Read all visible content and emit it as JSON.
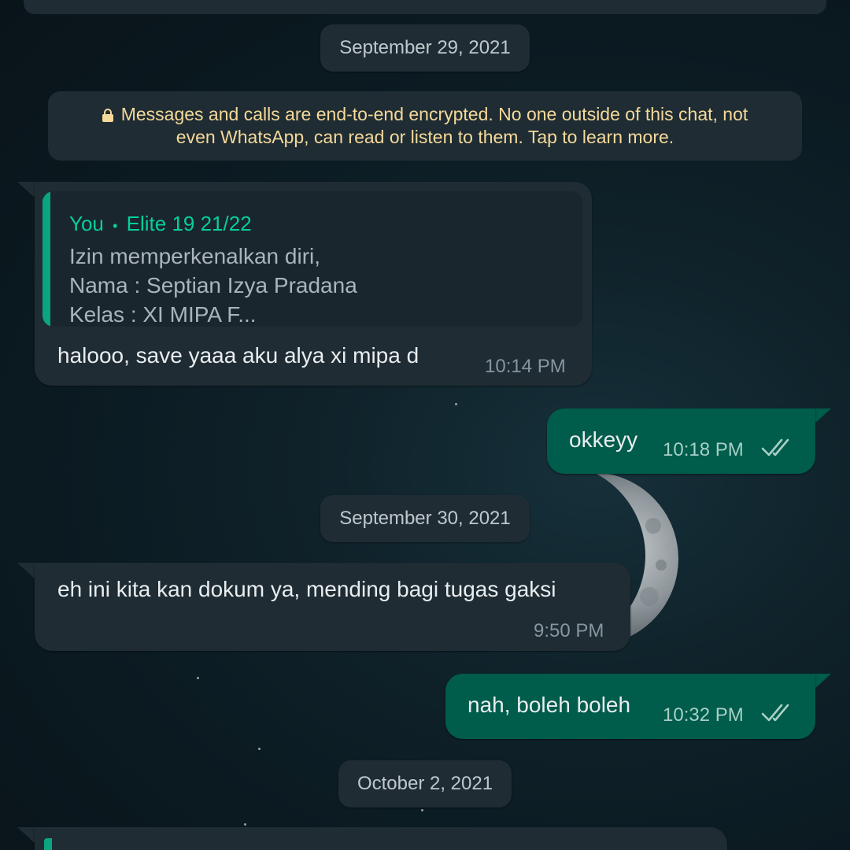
{
  "dates": [
    "September 29, 2021",
    "September 30, 2021",
    "October 2, 2021"
  ],
  "encryption_notice": {
    "line1": "Messages and calls are end-to-end encrypted. No one outside of this chat, not",
    "line2": "even WhatsApp, can read or listen to them. Tap to learn more.",
    "icon": "lock-icon"
  },
  "messages": [
    {
      "direction": "incoming",
      "quote": {
        "sender": "You",
        "separator": "•",
        "group": "Elite 19 21/22",
        "lines": [
          "Izin memperkenalkan diri,",
          "Nama : Septian Izya Pradana",
          "Kelas : XI MIPA F..."
        ]
      },
      "text": "halooo, save yaaa aku alya xi mipa d",
      "time": "10:14 PM"
    },
    {
      "direction": "outgoing",
      "text": "okkeyy",
      "time": "10:18 PM",
      "status_icon": "double-check-icon"
    },
    {
      "direction": "incoming",
      "text": "eh ini kita kan dokum ya, mending bagi tugas gaksi",
      "time": "9:50 PM"
    },
    {
      "direction": "outgoing",
      "text": "nah, boleh boleh",
      "time": "10:32 PM",
      "status_icon": "double-check-icon"
    }
  ],
  "colors": {
    "incoming_bubble": "#1f2c33",
    "outgoing_bubble": "#005c4b",
    "quote_accent": "#06cf9c",
    "notice_text": "#f5d99a"
  }
}
